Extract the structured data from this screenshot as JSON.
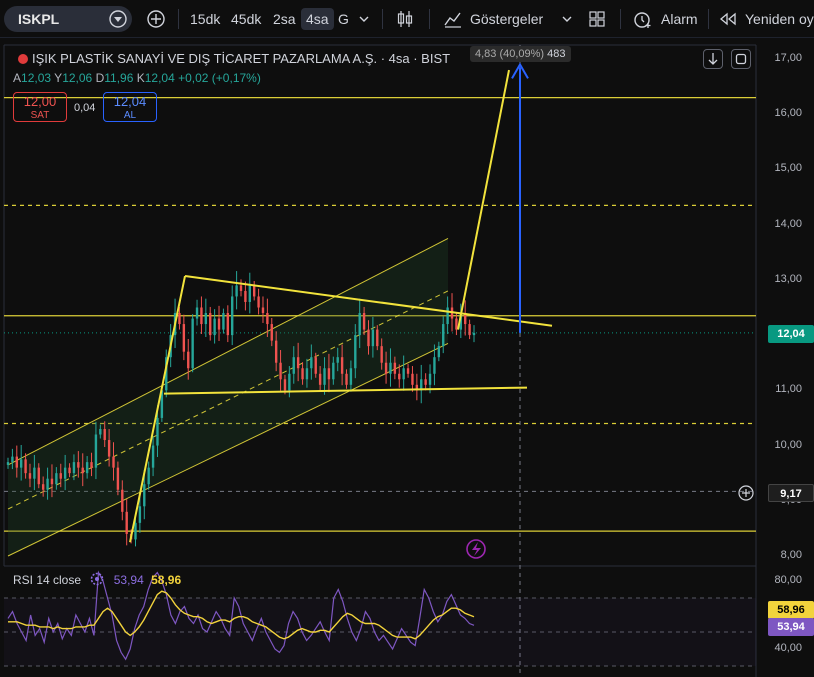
{
  "toolbar": {
    "symbol": "ISKPL",
    "timeframes": [
      "15dk",
      "45dk",
      "2sa",
      "4sa",
      "G"
    ],
    "active_timeframe": "4sa",
    "indicators_label": "Göstergeler",
    "alarm_label": "Alarm",
    "replay_label": "Yeniden oy"
  },
  "legend": {
    "title": "IŞIK PLASTİK SANAYİ VE DIŞ TİCARET PAZARLAMA A.Ş. · 4sa · BIST",
    "open_label": "A",
    "open": "12,03",
    "high_label": "Y",
    "high": "12,06",
    "low_label": "D",
    "low": "11,96",
    "close_label": "K",
    "close": "12,04",
    "change": "+0,02 (+0,17%)"
  },
  "order": {
    "sell_price": "12,00",
    "sell_label": "SAT",
    "spread": "0,04",
    "buy_price": "12,04",
    "buy_label": "AL"
  },
  "ruler": {
    "change": "4,83 (40,09%)",
    "bars": "483"
  },
  "price_axis": {
    "labels": [
      "17,00",
      "16,00",
      "15,00",
      "14,00",
      "13,00",
      "12,00",
      "11,00",
      "10,00",
      "9,00",
      "8,00"
    ],
    "current_price": "12,04",
    "crosshair_price": "9,17"
  },
  "rsi": {
    "label": "RSI 14 close",
    "rsi_value": "53,94",
    "ma_value": "58,96",
    "axis_labels": [
      "80,00",
      "40,00"
    ]
  },
  "colors": {
    "background": "#0e0e0e",
    "up": "#26a69a",
    "down": "#ef5350",
    "trendline": "#f2e33c",
    "ruler": "#2962ff",
    "rsi_line": "#7e57c2",
    "rsi_ma": "#f2d33c",
    "price_tag": "#089981"
  },
  "chart_data": [
    {
      "type": "candlestick",
      "title": "IŞIK PLASTİK SANAYİ VE DIŞ TİCARET PAZARLAMA A.Ş. · 4sa · BIST",
      "ylim": [
        8.0,
        17.0
      ],
      "y_scale": "linear",
      "close_path": [
        9.7,
        9.8,
        9.6,
        9.75,
        9.5,
        9.4,
        9.6,
        9.3,
        9.2,
        9.4,
        9.3,
        9.5,
        9.4,
        9.6,
        9.5,
        9.7,
        9.6,
        9.5,
        9.7,
        9.6,
        10.2,
        10.3,
        10.1,
        9.8,
        9.6,
        9.2,
        8.8,
        8.4,
        8.3,
        8.6,
        8.9,
        9.3,
        9.6,
        10.0,
        10.5,
        11.0,
        11.6,
        12.0,
        12.4,
        12.2,
        11.7,
        11.4,
        12.3,
        12.5,
        12.2,
        12.4,
        12.0,
        12.3,
        12.1,
        12.4,
        12.0,
        12.7,
        12.9,
        12.8,
        12.6,
        12.9,
        12.7,
        12.5,
        12.4,
        12.2,
        11.9,
        11.5,
        11.2,
        11.0,
        11.3,
        11.6,
        11.4,
        11.2,
        11.4,
        11.6,
        11.3,
        11.1,
        11.4,
        11.2,
        11.5,
        11.6,
        11.3,
        11.1,
        11.4,
        12.0,
        12.4,
        12.1,
        11.8,
        12.1,
        11.8,
        11.5,
        11.3,
        11.5,
        11.3,
        11.2,
        11.4,
        11.3,
        11.1,
        11.0,
        11.2,
        11.1,
        11.3,
        11.6,
        11.8,
        12.2,
        12.5,
        12.3,
        12.1,
        12.4,
        12.2,
        12.0,
        12.04
      ],
      "last_close": 12.04,
      "horizontal_levels": [
        16.3,
        14.35,
        12.35,
        10.4,
        8.45
      ],
      "drawings": [
        "ascending-channel",
        "triangle",
        "target-projection",
        "price-ruler"
      ]
    },
    {
      "type": "line",
      "title": "RSI 14 close",
      "ylim": [
        30,
        90
      ],
      "levels": [
        70,
        50,
        30
      ],
      "series": [
        {
          "name": "RSI",
          "values": [
            58,
            62,
            55,
            50,
            45,
            60,
            48,
            52,
            44,
            58,
            50,
            55,
            46,
            52,
            48,
            60,
            55,
            50,
            58,
            48,
            85,
            80,
            70,
            60,
            45,
            38,
            34,
            40,
            52,
            60,
            65,
            75,
            82,
            85,
            80,
            72,
            60,
            55,
            62,
            65,
            58,
            55,
            60,
            52,
            50,
            56,
            62,
            58,
            52,
            48,
            70,
            65,
            55,
            50,
            45,
            52,
            58,
            50,
            45,
            40,
            38,
            42,
            55,
            62,
            58,
            50,
            45,
            48,
            52,
            56,
            50,
            45,
            70,
            75,
            68,
            58,
            50,
            45,
            52,
            62,
            58,
            50,
            45,
            48,
            44,
            40,
            46,
            52,
            48,
            44,
            42,
            58,
            75,
            70,
            62,
            56,
            60,
            68,
            72,
            66,
            60,
            58,
            55,
            53.94
          ]
        },
        {
          "name": "RSI-based MA",
          "values": [
            56,
            56,
            56,
            55,
            54,
            54,
            54,
            53,
            53,
            53,
            52,
            53,
            52,
            52,
            52,
            53,
            53,
            53,
            54,
            54,
            58,
            62,
            64,
            62,
            58,
            54,
            50,
            48,
            50,
            53,
            57,
            62,
            67,
            72,
            74,
            73,
            70,
            66,
            63,
            61,
            60,
            59,
            59,
            58,
            56,
            55,
            56,
            57,
            57,
            56,
            58,
            59,
            59,
            58,
            56,
            55,
            54,
            53,
            51,
            49,
            47,
            46,
            47,
            49,
            51,
            52,
            51,
            50,
            50,
            51,
            51,
            50,
            53,
            56,
            59,
            61,
            60,
            58,
            56,
            55,
            55,
            55,
            54,
            52,
            50,
            48,
            47,
            47,
            47,
            47,
            46,
            48,
            51,
            54,
            57,
            59,
            60,
            62,
            64,
            64,
            63,
            61,
            60,
            58.96
          ]
        }
      ]
    }
  ]
}
